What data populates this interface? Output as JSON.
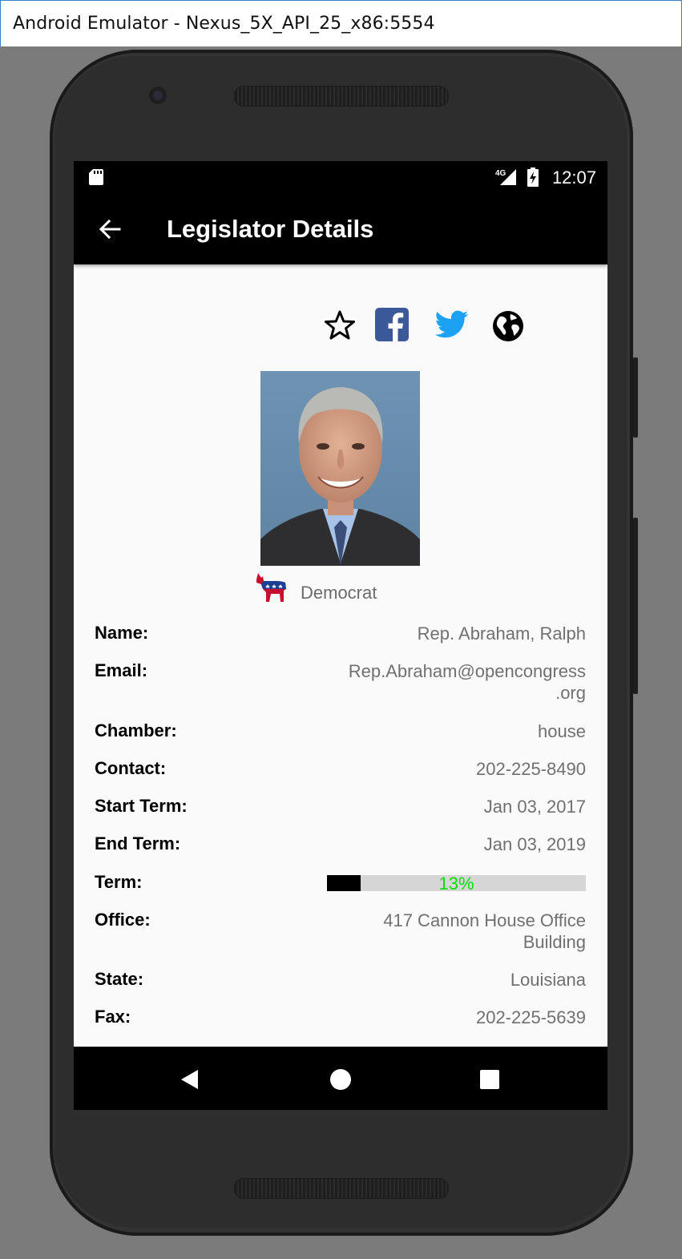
{
  "window": {
    "title": "Android Emulator - Nexus_5X_API_25_x86:5554"
  },
  "statusbar": {
    "time": "12:07",
    "network": "4G"
  },
  "appbar": {
    "title": "Legislator Details"
  },
  "icons": {
    "favorite": "star-outline-icon",
    "facebook": "facebook-icon",
    "twitter": "twitter-icon",
    "website": "globe-icon",
    "facebook_color": "#3b5998",
    "twitter_color": "#1da1f2"
  },
  "party": {
    "name": "Democrat"
  },
  "details": {
    "name_label": "Name:",
    "name_value": "Rep. Abraham, Ralph",
    "email_label": "Email:",
    "email_value_line1": "Rep.Abraham@opencongress",
    "email_value_line2": ".org",
    "chamber_label": "Chamber:",
    "chamber_value": "house",
    "contact_label": "Contact:",
    "contact_value": "202-225-8490",
    "start_label": "Start Term:",
    "start_value": "Jan 03, 2017",
    "end_label": "End Term:",
    "end_value": "Jan 03, 2019",
    "term_label": "Term:",
    "term_progress": 0.13,
    "term_text": "13%",
    "office_label": "Office:",
    "office_value_line1": "417 Cannon House Office",
    "office_value_line2": "Building",
    "state_label": "State:",
    "state_value": "Louisiana",
    "fax_label": "Fax:",
    "fax_value": "202-225-5639"
  }
}
